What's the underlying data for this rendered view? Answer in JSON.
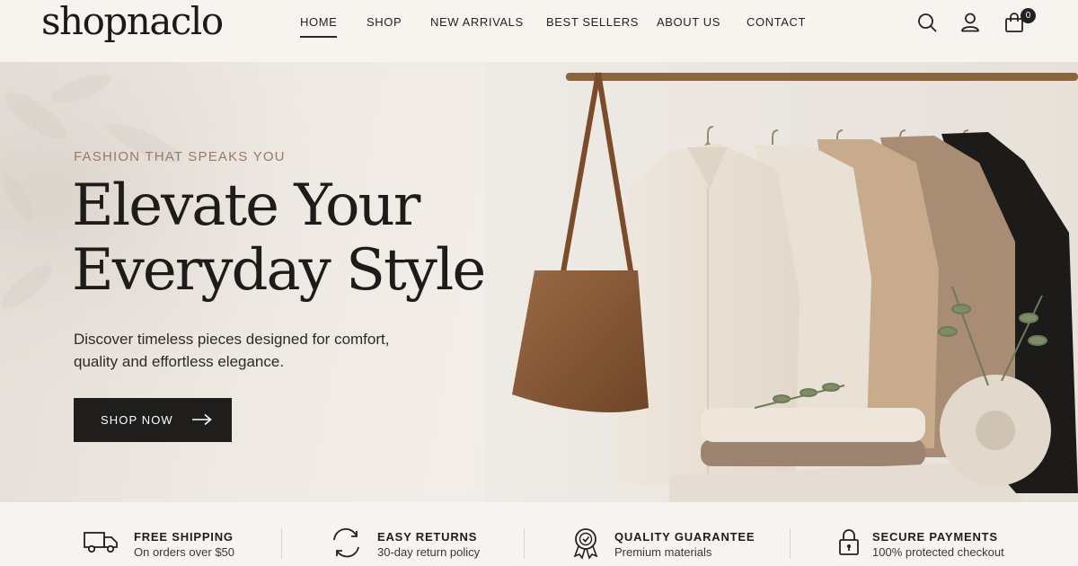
{
  "brand": {
    "name": "shopnaclo"
  },
  "nav": {
    "items": [
      {
        "label": "HOME",
        "active": true
      },
      {
        "label": "SHOP",
        "active": false
      },
      {
        "label": "NEW ARRIVALS",
        "active": false
      },
      {
        "label": "BEST SELLERS",
        "active": false
      },
      {
        "label": "ABOUT US",
        "active": false
      },
      {
        "label": "CONTACT",
        "active": false
      }
    ]
  },
  "header_icons": {
    "search": "search-icon",
    "account": "user-icon",
    "cart": "shopping-bag-icon",
    "cart_count": "0"
  },
  "hero": {
    "eyebrow": "FASHION THAT SPEAKS YOU",
    "headline_line1": "Elevate Your",
    "headline_line2": "Everyday Style",
    "subcopy_line1": "Discover timeless pieces designed for comfort,",
    "subcopy_line2": "quality and effortless elegance.",
    "cta_label": "SHOP NOW"
  },
  "features": [
    {
      "icon": "truck-icon",
      "title": "FREE SHIPPING",
      "subtitle": "On orders over $50"
    },
    {
      "icon": "returns-icon",
      "title": "EASY RETURNS",
      "subtitle": "30-day return policy"
    },
    {
      "icon": "award-badge-icon",
      "title": "QUALITY GUARANTEE",
      "subtitle": "Premium materials"
    },
    {
      "icon": "lock-icon",
      "title": "SECURE PAYMENTS",
      "subtitle": "100% protected checkout"
    }
  ],
  "colors": {
    "accent": "#9a7a63",
    "dark": "#1f1e1d",
    "background": "#f6f2ee"
  }
}
